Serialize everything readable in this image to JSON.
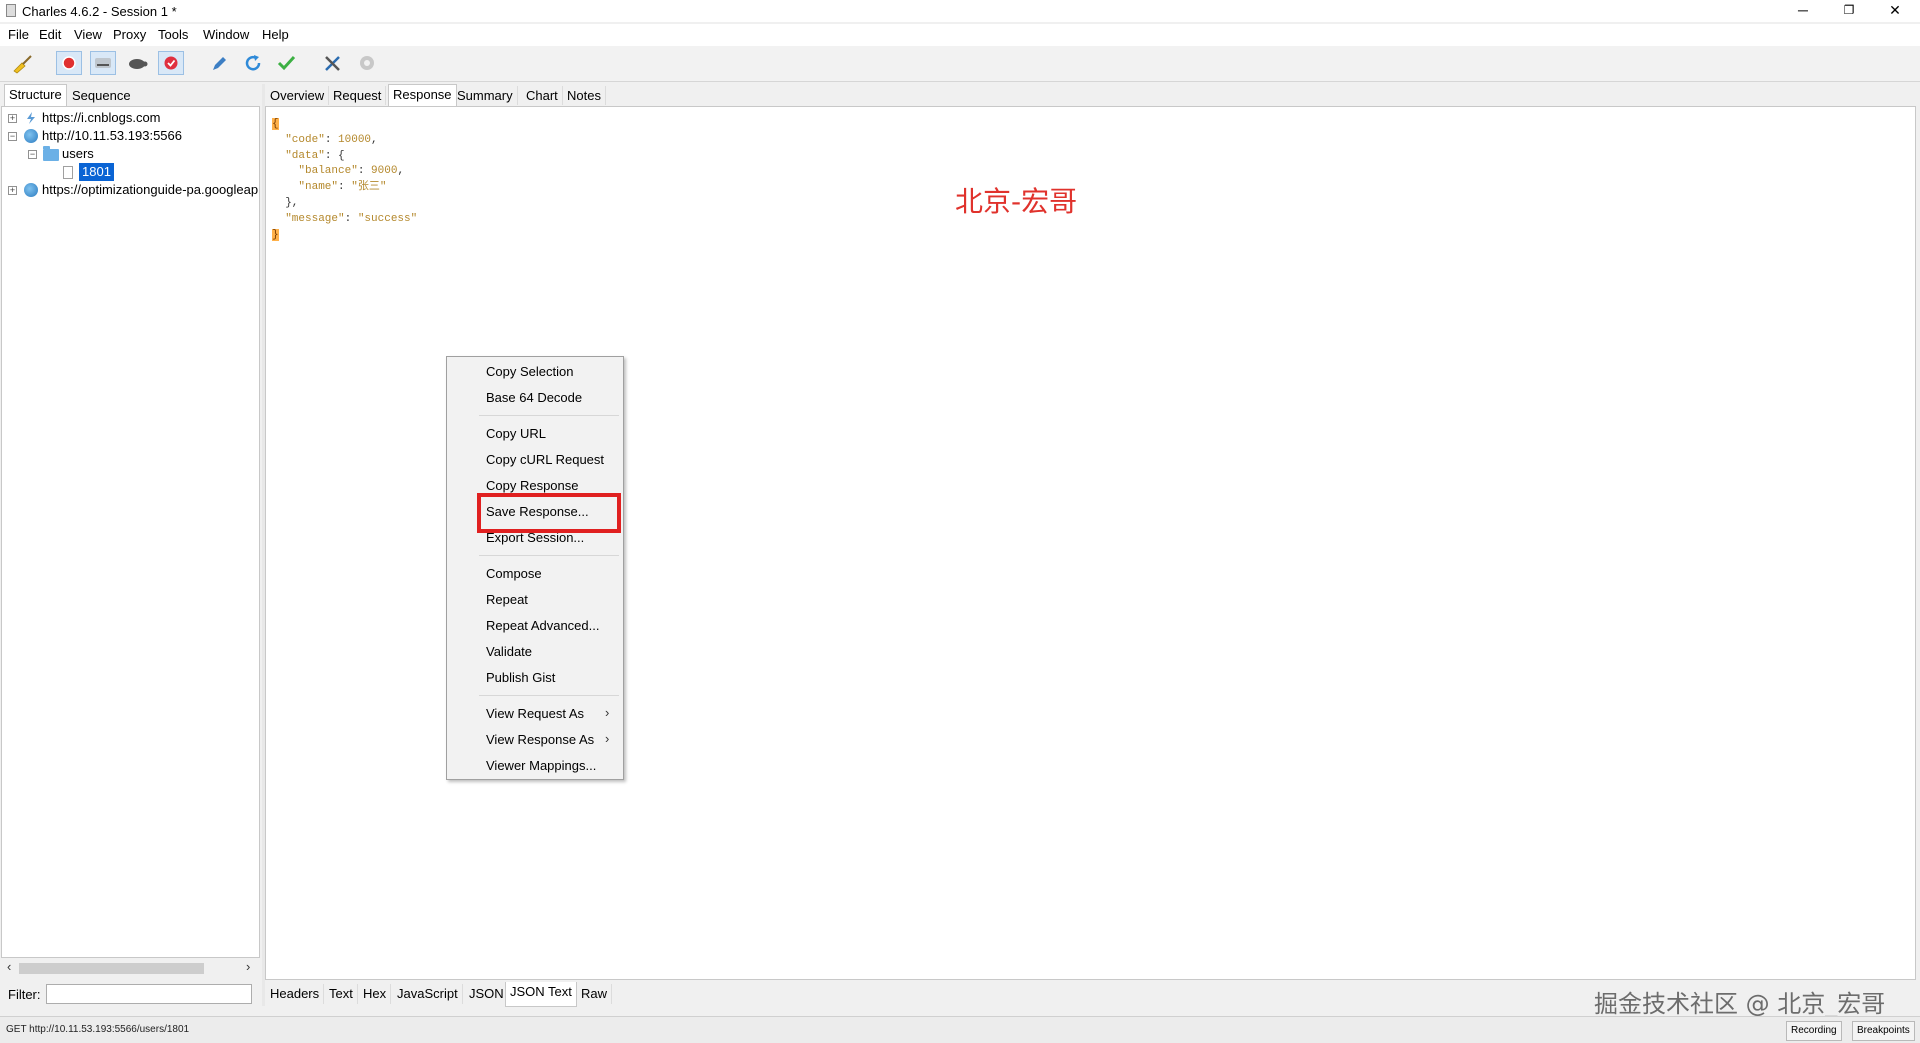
{
  "window": {
    "title": "Charles 4.6.2 - Session 1 *",
    "minimize": "─",
    "restore": "❐",
    "close": "✕"
  },
  "menubar": [
    "File",
    "Edit",
    "View",
    "Proxy",
    "Tools",
    "Window",
    "Help"
  ],
  "toolbar": {
    "icons": [
      "broom-icon",
      "record-icon",
      "throttle-icon",
      "turtle-icon",
      "breakpoint-icon",
      "pen-icon",
      "refresh-icon",
      "check-icon",
      "tools-icon",
      "settings-icon"
    ]
  },
  "left_tabs": {
    "structure": "Structure",
    "sequence": "Sequence"
  },
  "tree": {
    "host1": "https://i.cnblogs.com",
    "host2": "http://10.11.53.193:5566",
    "folder": "users",
    "leaf": "1801",
    "host3": "https://optimizationguide-pa.googleapis.com"
  },
  "filter": {
    "label": "Filter:",
    "value": ""
  },
  "right_tabs": [
    "Overview",
    "Request",
    "Response",
    "Summary",
    "Chart",
    "Notes"
  ],
  "active_right_tab": "Response",
  "json_body": {
    "open": "{",
    "code_key": "\"code\"",
    "code_val": "10000",
    "data_key": "\"data\"",
    "balance_key": "\"balance\"",
    "balance_val": "9000",
    "name_key": "\"name\"",
    "name_val": "\"张三\"",
    "message_key": "\"message\"",
    "message_val": "\"success\"",
    "close": "}"
  },
  "watermark_top": "北京-宏哥",
  "bottom_tabs": [
    "Headers",
    "Text",
    "Hex",
    "JavaScript",
    "JSON",
    "JSON Text",
    "Raw"
  ],
  "active_bottom_tab": "JSON Text",
  "watermark_bottom": "掘金技术社区 @ 北京_宏哥",
  "status": {
    "text": "GET http://10.11.53.193:5566/users/1801",
    "recording": "Recording",
    "breakpoints": "Breakpoints"
  },
  "context_menu": {
    "copy_selection": "Copy Selection",
    "base64_decode": "Base 64 Decode",
    "copy_url": "Copy URL",
    "copy_curl": "Copy cURL Request",
    "copy_response": "Copy Response",
    "save_response": "Save Response...",
    "export_session": "Export Session...",
    "compose": "Compose",
    "repeat": "Repeat",
    "repeat_advanced": "Repeat Advanced...",
    "validate": "Validate",
    "publish_gist": "Publish Gist",
    "view_request_as": "View Request As",
    "view_response_as": "View Response As",
    "viewer_mappings": "Viewer Mappings...",
    "submenu_arrow": "›"
  },
  "colors": {
    "highlight": "#e02020",
    "selection": "#0a64d4",
    "watermark_red": "#e0322c"
  }
}
